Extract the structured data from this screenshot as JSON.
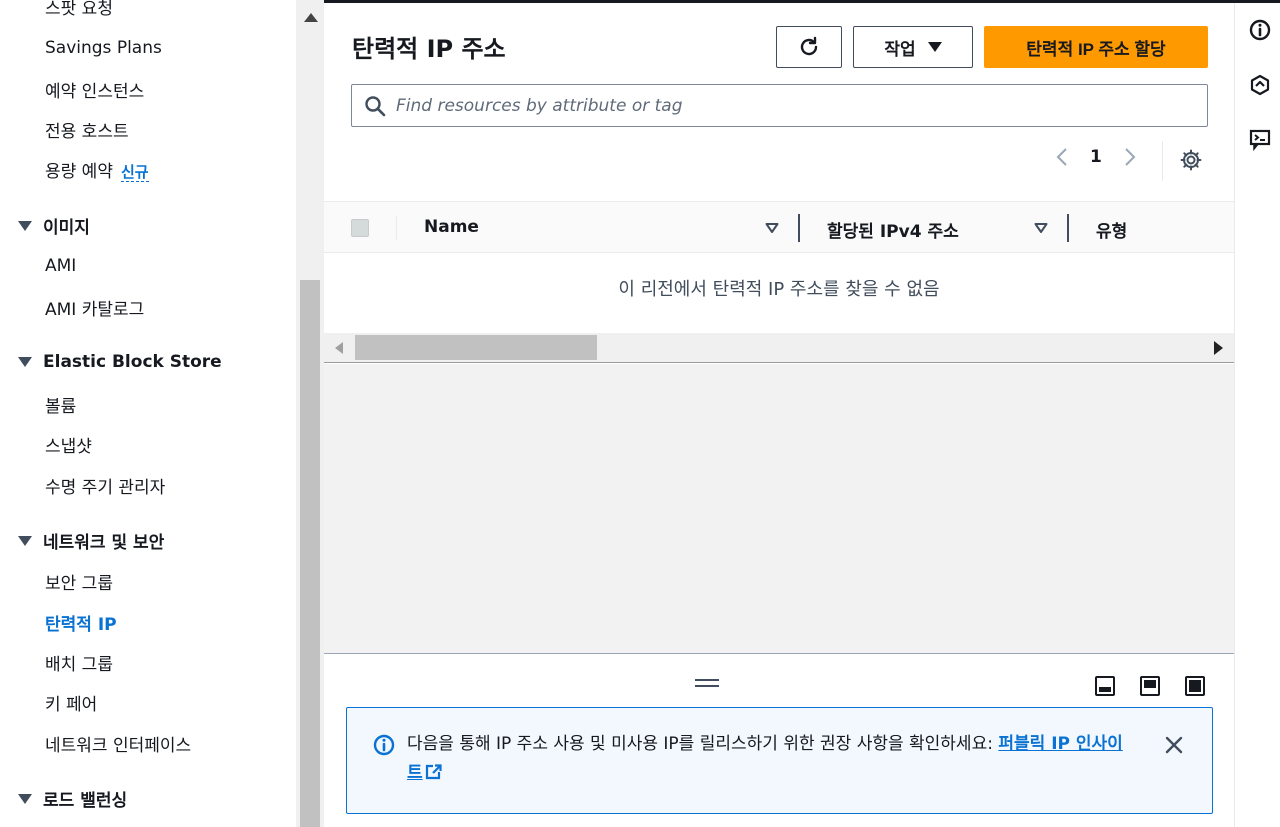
{
  "sidebar": {
    "items": [
      {
        "label": "스팟 요청"
      },
      {
        "label": "Savings Plans"
      },
      {
        "label": "예약 인스턴스"
      },
      {
        "label": "전용 호스트"
      },
      {
        "label": "용량 예약",
        "badge": "신규"
      }
    ],
    "sections": [
      {
        "title": "이미지",
        "items": [
          "AMI",
          "AMI 카탈로그"
        ]
      },
      {
        "title": "Elastic Block Store",
        "items": [
          "볼륨",
          "스냅샷",
          "수명 주기 관리자"
        ]
      },
      {
        "title": "네트워크 및 보안",
        "items": [
          "보안 그룹",
          "탄력적 IP",
          "배치 그룹",
          "키 페어",
          "네트워크 인터페이스"
        ]
      },
      {
        "title": "로드 밸런싱",
        "items": []
      }
    ],
    "active_item": "탄력적 IP"
  },
  "header": {
    "title": "탄력적 IP 주소",
    "actions_label": "작업",
    "primary_label": "탄력적 IP 주소 할당"
  },
  "search": {
    "placeholder": "Find resources by attribute or tag"
  },
  "pagination": {
    "current_page": "1"
  },
  "table": {
    "columns": [
      "Name",
      "할당된 IPv4 주소",
      "유형"
    ],
    "empty_message": "이 리전에서 탄력적 IP 주소를 찾을 수 없음"
  },
  "alert": {
    "text": "다음을 통해 IP 주소 사용 및 미사용 IP를 릴리스하기 위한 권장 사항을 확인하세요: ",
    "link_text": "퍼블릭 IP 인사이트"
  },
  "colors": {
    "primary": "#ff9900",
    "link": "#0972d3",
    "info_bg": "#f2f8fd"
  },
  "icons": [
    "refresh-icon",
    "search-icon",
    "settings-icon",
    "info-icon",
    "external-link-icon",
    "close-icon",
    "security-icon",
    "feedback-icon"
  ]
}
